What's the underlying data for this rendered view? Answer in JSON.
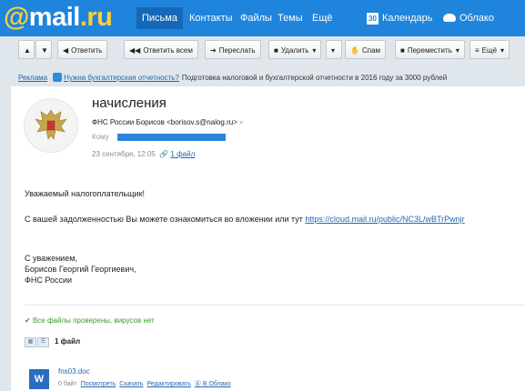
{
  "header": {
    "logo_main": "mail",
    "logo_suffix": ".ru",
    "nav": [
      "Письма",
      "Контакты",
      "Файлы",
      "Темы",
      "Ещё",
      "Календарь",
      "Облако"
    ],
    "calendar_day": "30"
  },
  "toolbar": {
    "reply": "Ответить",
    "reply_all": "Ответить всем",
    "forward": "Переслать",
    "delete": "Удалить",
    "spam": "Спам",
    "move": "Переместить",
    "more": "Ещё"
  },
  "ad": {
    "label": "Реклама",
    "link": "Нужна бухгалтерская отчетность?",
    "text": "Подготовка налоговой и бухгалтерской отчетности в 2016 году за 3000 рублей"
  },
  "message": {
    "subject": "начисления",
    "sender": "ФНС России Борисов <borisov.s@nalog.ru>",
    "to_label": "Кому",
    "date": "23 сентября, 12:05",
    "attachments_link": "1 файл",
    "greeting": "Уважаемый налогоплательщик!",
    "body_text": "С вашей задолженностью Вы можете ознакомиться во вложении или тут",
    "body_link": "https://cloud.mail.ru/public/NC3L/wBTrPwnjr",
    "sign_1": "С уважением,",
    "sign_2": "Борисов Георгий Георгиевич,",
    "sign_3": "ФНС России",
    "scan_status": "Все файлы проверены, вирусов нет",
    "files_count": "1 файл",
    "file": {
      "icon": "W",
      "name": "fns03.doc",
      "size": "0 байт",
      "view": "Посмотреть",
      "download": "Скачать",
      "edit": "Редактировать",
      "cloud": "В Облако"
    }
  },
  "colors": {
    "header_bg": "#1f84dc",
    "link": "#2467b3",
    "ok": "#3c9a2d"
  }
}
